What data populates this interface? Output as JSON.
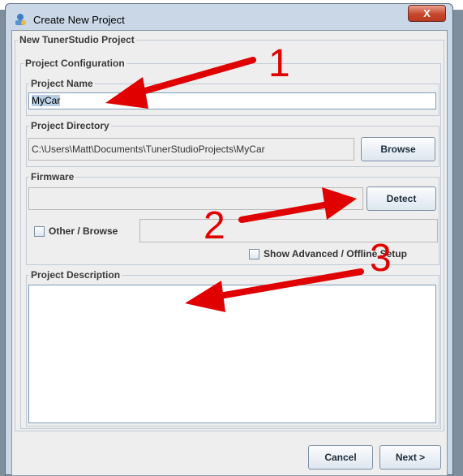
{
  "window": {
    "title": "Create New Project",
    "close_label": "X"
  },
  "project": {
    "group_label": "New TunerStudio Project",
    "config_label": "Project Configuration",
    "name_label": "Project Name",
    "name_value": "MyCar",
    "directory_label": "Project Directory",
    "directory_value": "C:\\Users\\Matt\\Documents\\TunerStudioProjects\\MyCar",
    "browse_label": "Browse",
    "firmware_label": "Firmware",
    "firmware_value": "",
    "detect_label": "Detect",
    "other_browse_label": "Other / Browse",
    "other_browse_checked": false,
    "other_browse_value": "",
    "advanced_label": "Show Advanced / Offline Setup",
    "advanced_checked": false,
    "description_label": "Project Description",
    "description_value": ""
  },
  "footer": {
    "cancel_label": "Cancel",
    "next_label": "Next >"
  },
  "annotations": {
    "color": "#e00000",
    "labels": [
      "1",
      "2",
      "3"
    ]
  }
}
